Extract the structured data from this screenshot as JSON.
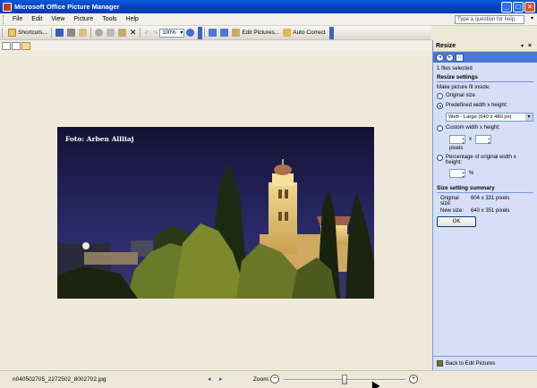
{
  "window": {
    "title": "Microsoft Office Picture Manager",
    "controls": [
      "_",
      "□",
      "×"
    ]
  },
  "menubar": {
    "items": [
      "File",
      "Edit",
      "View",
      "Picture",
      "Tools",
      "Help"
    ],
    "help_placeholder": "Type a question for help"
  },
  "toolbar": {
    "shortcuts_label": "Shortcuts...",
    "zoom_value": "100%",
    "edit_pictures_label": "Edit Pictures...",
    "auto_correct_label": "Auto Correct"
  },
  "canvas": {
    "photo_caption": "Foto: Arben Allliaj"
  },
  "statusbar": {
    "filename": "n040502705_2272502_8002702.jpg",
    "zoom_label": "Zoom:",
    "zoom_slider_fraction": 0.5
  },
  "taskpane": {
    "title": "Resize",
    "files_selected": "1 files selected",
    "resize_settings_heading": "Resize settings",
    "fit_label": "Make picture fit inside:",
    "options": {
      "original": "Original size",
      "predefined": "Predefined width x height:",
      "custom": "Custom width x height:",
      "percentage": "Percentage of original width x height:"
    },
    "predefined_value": "Web - Large (640 x 480 px)",
    "x_separator": "x",
    "pixels_label": "pixels",
    "percent_sign": "%",
    "summary_heading": "Size setting summary",
    "original_size_key": "Original size:",
    "original_size_value": "604 x 331 pixels",
    "new_size_key": "New size:",
    "new_size_value": "640 x 351 pixels",
    "ok_label": "OK",
    "back_label": "Back to Edit Pictures"
  },
  "colors": {
    "titlebar": "#0842c0",
    "taskpane_bg": "#d6dff7",
    "canvas_bg": "#efeadc"
  }
}
